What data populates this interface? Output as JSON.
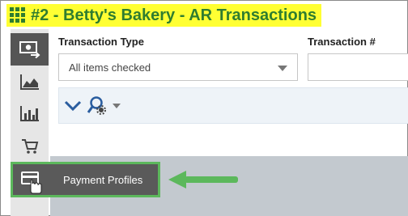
{
  "header": {
    "title": "#2 - Betty's Bakery - AR Transactions",
    "title_color": "#2f7d2f",
    "highlight_color": "#ffff33"
  },
  "sidebar": {
    "items": [
      {
        "icon": "money-transfer-icon",
        "active": true
      },
      {
        "icon": "area-chart-icon",
        "active": false
      },
      {
        "icon": "bar-chart-icon",
        "active": false
      },
      {
        "icon": "cart-icon",
        "active": false
      },
      {
        "icon": "payment-card-icon",
        "active": false
      }
    ]
  },
  "filters": {
    "transaction_type_label": "Transaction Type",
    "transaction_type_value": "All items checked",
    "transaction_number_label": "Transaction #"
  },
  "toolbar": {
    "expand_icon": "chevron-down-icon",
    "search_settings_icon": "search-settings-icon"
  },
  "tooltip": {
    "label": "Payment Profiles",
    "accent_color": "#5cb85c"
  }
}
